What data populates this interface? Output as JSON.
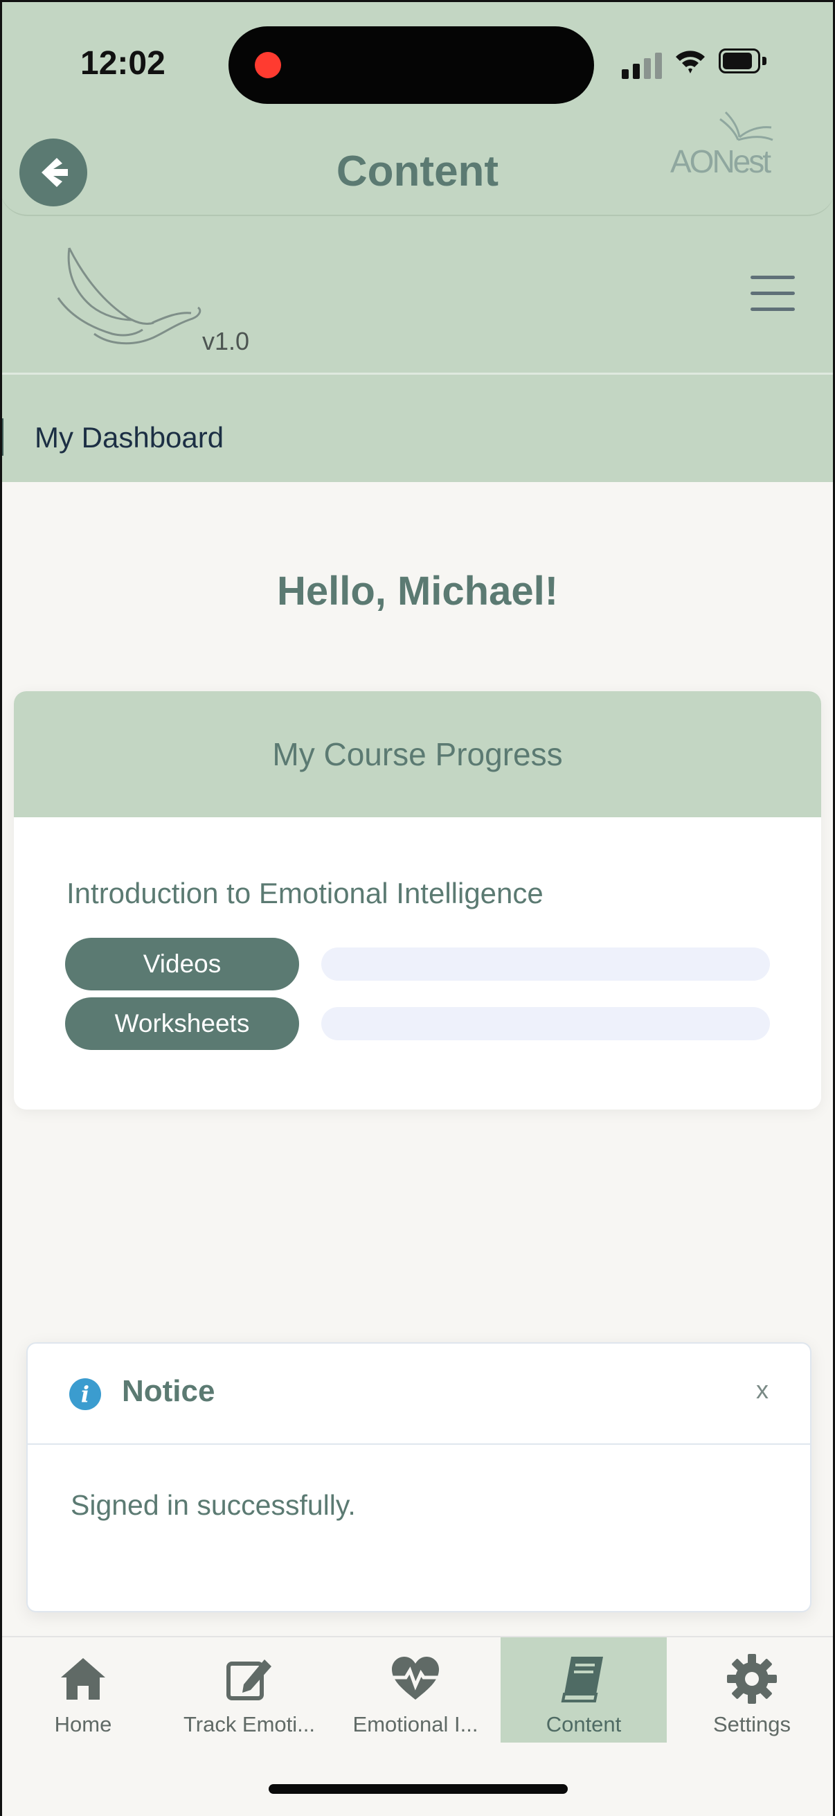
{
  "status_bar": {
    "time": "12:02"
  },
  "nav_header": {
    "title": "Content",
    "brand": "AONest"
  },
  "app_header": {
    "version": "v1.0"
  },
  "breadcrumb": {
    "label": "My Dashboard"
  },
  "greeting": "Hello, Michael!",
  "progress_card": {
    "title": "My Course Progress",
    "course": "Introduction to Emotional Intelligence",
    "items": [
      {
        "label": "Videos",
        "progress_percent": 0
      },
      {
        "label": "Worksheets",
        "progress_percent": 0
      }
    ]
  },
  "notice": {
    "title": "Notice",
    "close_label": "x",
    "message": "Signed in successfully."
  },
  "tab_bar": {
    "tabs": [
      {
        "label": "Home",
        "icon": "home-icon"
      },
      {
        "label": "Track Emoti...",
        "icon": "edit-icon"
      },
      {
        "label": "Emotional I...",
        "icon": "heartbeat-icon"
      },
      {
        "label": "Content",
        "icon": "book-icon",
        "active": true
      },
      {
        "label": "Settings",
        "icon": "gear-icon"
      }
    ]
  },
  "colors": {
    "header_green": "#c3d6c3",
    "accent_green": "#5b7a72",
    "background": "#f7f6f3",
    "info_blue": "#3b9ccf"
  }
}
